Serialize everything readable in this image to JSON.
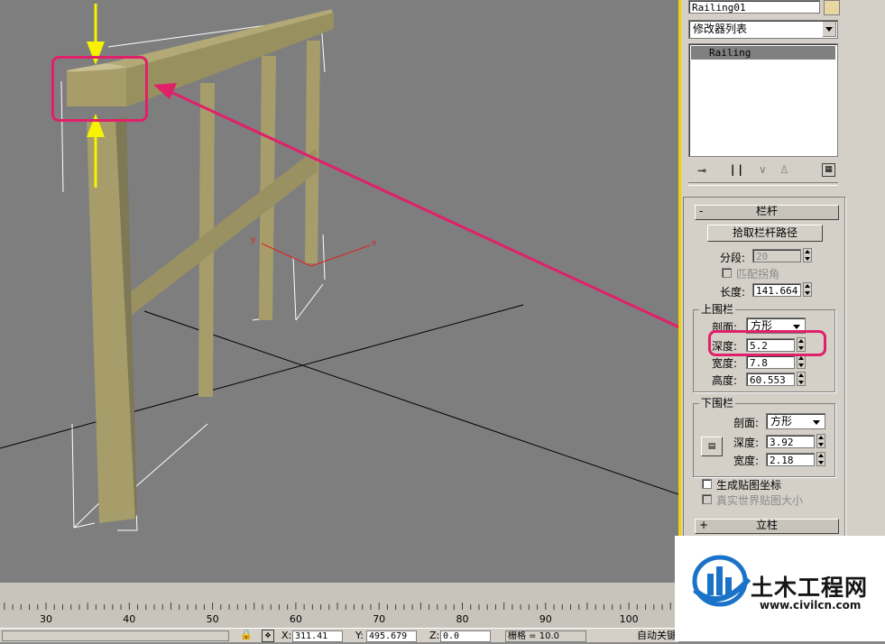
{
  "viewport": {
    "axis_labels": {
      "y": "y",
      "x": "x"
    },
    "colors": {
      "background": "#7e7e7e",
      "wood": "#a69d6b",
      "wood_dark": "#8a8260",
      "highlight": "#e0206a",
      "arrow_yellow": "#f6f200"
    }
  },
  "panel": {
    "object_name": "Railing01",
    "modifier_list": "修改器列表",
    "stack_item": "Railing",
    "stack_icons": [
      "pin-icon",
      "show-end-result-icon",
      "make-unique-icon",
      "remove-modifier-icon",
      "configure-sets-icon"
    ],
    "rollout_railing": {
      "sign": "-",
      "title": "栏杆",
      "pick_path_button": "拾取栏杆路径",
      "segments_label": "分段:",
      "segments_value": "20",
      "match_corners_label": "匹配拐角",
      "length_label": "长度:",
      "length_value": "141.664",
      "top_rail": {
        "title": "上围栏",
        "profile_label": "剖面:",
        "profile_value": "方形",
        "depth_label": "深度:",
        "depth_value": "5.2",
        "width_label": "宽度:",
        "width_value": "7.8",
        "height_label": "高度:",
        "height_value": "60.553"
      },
      "lower_rail": {
        "title": "下围栏",
        "profile_label": "剖面:",
        "profile_value": "方形",
        "depth_label": "深度:",
        "depth_value": "3.92",
        "width_label": "宽度:",
        "width_value": "2.18"
      },
      "gen_mapping_label": "生成贴图坐标",
      "real_world_label": "真实世界贴图大小"
    },
    "rollout_posts": {
      "sign": "+",
      "title": "立柱"
    }
  },
  "timeline": {
    "ticks": [
      "30",
      "40",
      "50",
      "60",
      "70",
      "80",
      "90",
      "100"
    ]
  },
  "statusbar": {
    "x_label": "X:",
    "x_value": "311.41",
    "y_label": "Y:",
    "y_value": "495.679",
    "z_label": "Z:",
    "z_value": "0.0",
    "grid_label": "栅格 = 10.0",
    "auto_key": "自动关键"
  },
  "watermark": {
    "title": "土木工程网",
    "url": "www.civilcn.com"
  }
}
